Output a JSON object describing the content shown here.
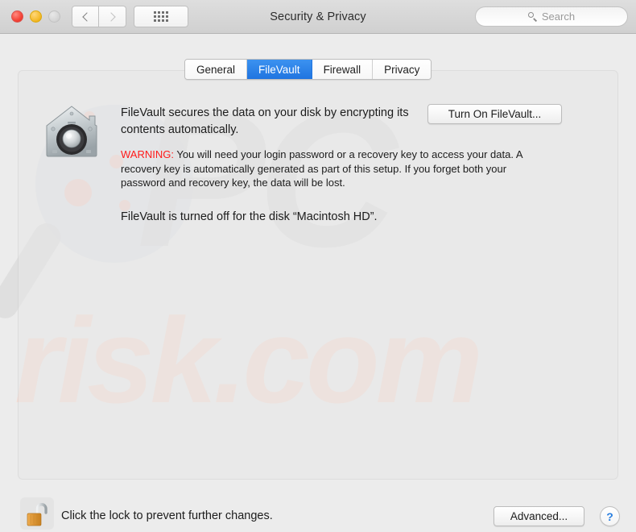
{
  "window": {
    "title": "Security & Privacy",
    "traffic_lights": [
      "close",
      "minimize",
      "zoom"
    ],
    "nav": {
      "back_icon": "chevron-left-icon",
      "forward_icon": "chevron-right-icon"
    },
    "grid_button_icon": "grid-dots-icon"
  },
  "search": {
    "placeholder": "Search",
    "value": "",
    "icon": "search-icon"
  },
  "tabs": [
    {
      "label": "General",
      "active": false
    },
    {
      "label": "FileVault",
      "active": true
    },
    {
      "label": "Firewall",
      "active": false
    },
    {
      "label": "Privacy",
      "active": false
    }
  ],
  "filevault": {
    "icon": "filevault-safe-icon",
    "heading": "FileVault secures the data on your disk by encrypting its contents automatically.",
    "warning_label": "WARNING:",
    "warning_text": " You will need your login password or a recovery key to access your data. A recovery key is automatically generated as part of this setup. If you forget both your password and recovery key, the data will be lost.",
    "status": "FileVault is turned off for the disk “Macintosh HD”.",
    "turn_on_button": "Turn On FileVault..."
  },
  "footer": {
    "lock_icon": "unlocked-padlock-icon",
    "lock_label": "Click the lock to prevent further changes.",
    "advanced_button": "Advanced...",
    "help_button": "?"
  },
  "watermark": {
    "text_primary": "PC",
    "text_secondary": "risk.com",
    "loupe_icon": "magnifier-watermark-icon"
  },
  "colors": {
    "accent": "#1f74e0",
    "warning": "#ff1a1a",
    "titlebar": "#d3d3d3",
    "background": "#ececec",
    "help_blue": "#2a7fe0"
  }
}
